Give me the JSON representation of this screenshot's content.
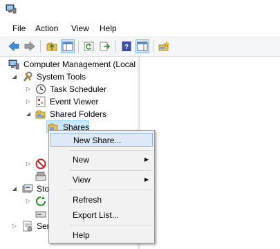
{
  "menubar": {
    "items": [
      "File",
      "Action",
      "View",
      "Help"
    ]
  },
  "toolbar": {
    "buttons": [
      "back-icon",
      "forward-icon",
      "up-folder-icon",
      "show-hide-tree-icon",
      "refresh-icon",
      "export-list-icon",
      "help-icon",
      "action-pane-icon",
      "new-share-icon"
    ]
  },
  "tree": {
    "root": "Computer Management (Local",
    "system_tools": "System Tools",
    "task_scheduler": "Task Scheduler",
    "event_viewer": "Event Viewer",
    "shared_folders": "Shared Folders",
    "shares": "Shares",
    "storage_partial": "Sto",
    "services_partial": "Ser"
  },
  "context_menu": {
    "new_share": "New Share...",
    "new": "New",
    "view": "View",
    "refresh": "Refresh",
    "export_list": "Export List...",
    "help": "Help"
  },
  "colors": {
    "selection": "#cce8ff",
    "menu_highlight": "#dde9f6",
    "accent": "#3c8fd9"
  }
}
